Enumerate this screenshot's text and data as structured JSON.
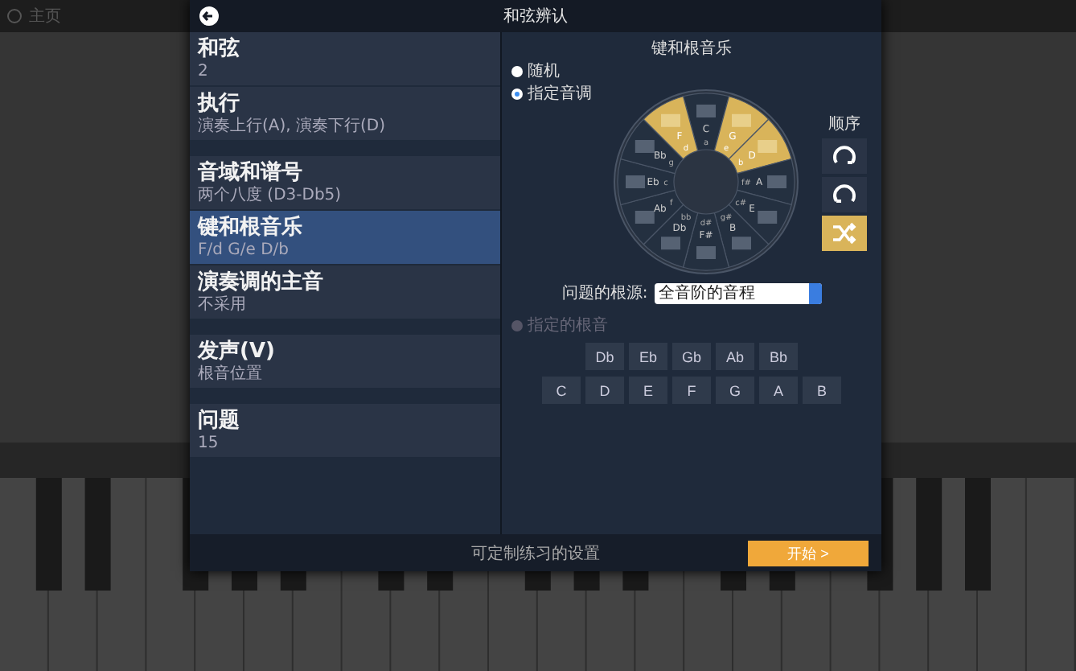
{
  "background": {
    "home_label": "主页"
  },
  "dialog": {
    "title": "和弦辨认",
    "groups": [
      {
        "items": [
          {
            "title": "和弦",
            "subtitle": "2",
            "selected": false
          },
          {
            "title": "执行",
            "subtitle": "演奏上行(A), 演奏下行(D)",
            "selected": false
          }
        ]
      },
      {
        "items": [
          {
            "title": "音域和谱号",
            "subtitle": "两个八度 (D3-Db5)",
            "selected": false
          },
          {
            "title": "键和根音乐",
            "subtitle": "F/d G/e D/b",
            "selected": true
          },
          {
            "title": "演奏调的主音",
            "subtitle": "不采用",
            "selected": false
          }
        ]
      },
      {
        "items": [
          {
            "title": "发声(V)",
            "subtitle": "根音位置",
            "selected": false
          }
        ]
      },
      {
        "items": [
          {
            "title": "问题",
            "subtitle": "15",
            "selected": false
          }
        ]
      }
    ],
    "panel": {
      "title": "键和根音乐",
      "mode_options": [
        {
          "label": "随机",
          "selected": false
        },
        {
          "label": "指定音调",
          "selected": true
        }
      ],
      "keys": [
        {
          "major": "C",
          "minor": "a",
          "selected": false
        },
        {
          "major": "G",
          "minor": "e",
          "selected": true
        },
        {
          "major": "D",
          "minor": "b",
          "selected": true
        },
        {
          "major": "A",
          "minor": "f#",
          "selected": false
        },
        {
          "major": "E",
          "minor": "c#",
          "selected": false
        },
        {
          "major": "B",
          "minor": "g#",
          "selected": false
        },
        {
          "major": "F#",
          "minor": "d#",
          "selected": false
        },
        {
          "major": "Db",
          "minor": "bb",
          "selected": false
        },
        {
          "major": "Ab",
          "minor": "f",
          "selected": false
        },
        {
          "major": "Eb",
          "minor": "c",
          "selected": false
        },
        {
          "major": "Bb",
          "minor": "g",
          "selected": false
        },
        {
          "major": "F",
          "minor": "d",
          "selected": true
        }
      ],
      "order": {
        "label": "顺序",
        "options": [
          {
            "kind": "ascending",
            "selected": false
          },
          {
            "kind": "descending",
            "selected": false
          },
          {
            "kind": "shuffle",
            "selected": true
          }
        ]
      },
      "root_source": {
        "label": "问题的根源:",
        "value": "全音阶的音程"
      },
      "root_radio": {
        "label": "指定的根音",
        "disabled": true
      },
      "note_rows": [
        [
          "Db",
          "Eb",
          "Gb",
          "Ab",
          "Bb"
        ],
        [
          "C",
          "D",
          "E",
          "F",
          "G",
          "A",
          "B"
        ]
      ]
    },
    "footer": {
      "caption": "可定制练习的设置",
      "start_button": "开始 >"
    }
  }
}
